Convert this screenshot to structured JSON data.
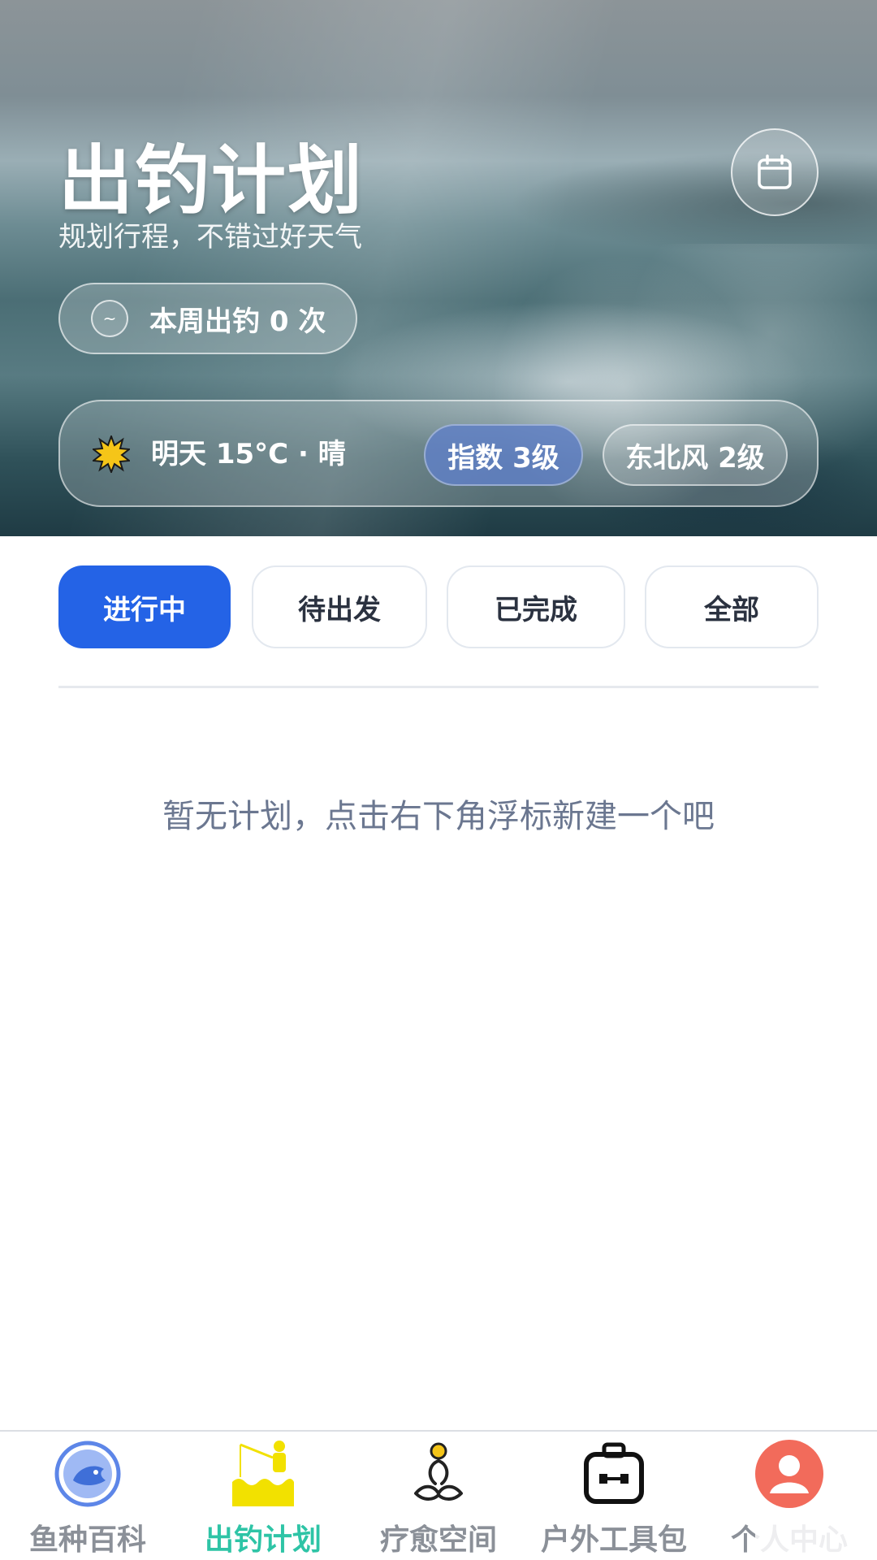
{
  "header": {
    "title": "出钓计划",
    "subtitle": "规划行程，不错过好天气",
    "calendar_icon": "calendar-icon",
    "week_count": "本周出钓 0 次"
  },
  "weather": {
    "icon": "sun-icon",
    "forecast": "明天 15°C · 晴",
    "index": "指数 3级",
    "wind": "东北风 2级"
  },
  "tabs": [
    {
      "label": "进行中",
      "active": true
    },
    {
      "label": "待出发",
      "active": false
    },
    {
      "label": "已完成",
      "active": false
    },
    {
      "label": "全部",
      "active": false
    }
  ],
  "empty_state": "暂无计划，点击右下角浮标新建一个吧",
  "bottom_nav": [
    {
      "label": "鱼种百科",
      "icon": "fish-icon"
    },
    {
      "label": "出钓计划",
      "icon": "angler-icon",
      "active": true
    },
    {
      "label": "疗愈空间",
      "icon": "meditation-icon"
    },
    {
      "label": "户外工具包",
      "icon": "toolbox-icon"
    },
    {
      "label": "个人中心",
      "icon": "user-icon"
    }
  ],
  "colors": {
    "accent": "#2463e6",
    "nav_active": "#2ec4a6",
    "nav_inactive": "#8b9098"
  }
}
